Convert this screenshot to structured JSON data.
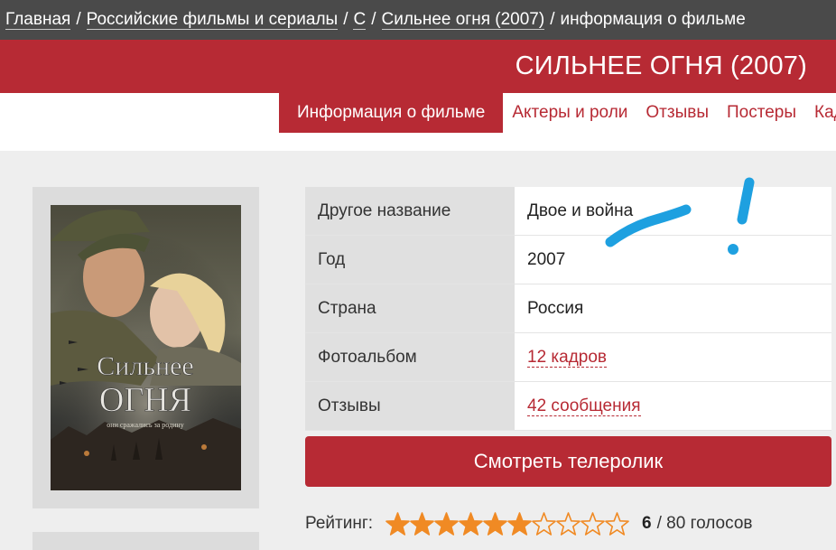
{
  "breadcrumb": {
    "items": [
      "Главная",
      "Российские фильмы и сериалы",
      "С",
      "Сильнее огня (2007)"
    ],
    "current": "информация о фильме",
    "separator": "/"
  },
  "page_title": "СИЛЬНЕЕ ОГНЯ (2007)",
  "tabs": [
    "Информация о фильме",
    "Актеры и роли",
    "Отзывы",
    "Постеры",
    "Кадры"
  ],
  "poster": {
    "title_line1": "Сильнее",
    "title_line2": "огня",
    "tagline": "они сражались за родину"
  },
  "info_rows": [
    {
      "label": "Другое название",
      "value": "Двое и война",
      "link": false
    },
    {
      "label": "Год",
      "value": "2007",
      "link": false
    },
    {
      "label": "Страна",
      "value": "Россия",
      "link": false
    },
    {
      "label": "Фотоальбом",
      "value": "12 кадров",
      "link": true
    },
    {
      "label": "Отзывы",
      "value": "42 сообщения",
      "link": true
    }
  ],
  "trailer_button": "Смотреть телеролик",
  "rating": {
    "label": "Рейтинг:",
    "score": "6",
    "votes_text": "/ 80 голосов",
    "stars_total": 10,
    "stars_filled": 6
  },
  "colors": {
    "accent": "#b72a34",
    "crumb_bg": "#4a4a4a",
    "star": "#f08a24",
    "scribble": "#1ea0e0"
  }
}
